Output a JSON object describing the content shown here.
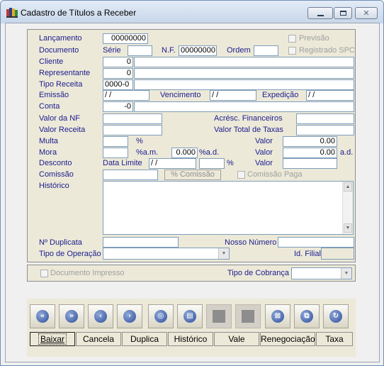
{
  "window": {
    "title": "Cadastro de Títulos a Receber"
  },
  "form": {
    "lancamento_label": "Lançamento",
    "lancamento_value": "00000000",
    "previsao_label": "Previsão",
    "documento_label": "Documento",
    "serie_label": "Série",
    "serie_value": "",
    "nf_label": "N.F.",
    "nf_value": "00000000",
    "ordem_label": "Ordem",
    "ordem_value": "",
    "registrado_spc_label": "Registrado SPC",
    "cliente_label": "Cliente",
    "cliente_value": "0",
    "representante_label": "Representante",
    "representante_value": "0",
    "tipo_receita_label": "Tipo Receita",
    "tipo_receita_value": "0000-0",
    "emissao_label": "Emissão",
    "emissao_value": " / /",
    "vencimento_label": "Vencimento",
    "vencimento_value": " / /",
    "expedicao_label": "Expedição",
    "expedicao_value": " / /",
    "conta_label": "Conta",
    "conta_value": "-0",
    "valor_nf_label": "Valor da NF",
    "acresc_label": "Acrésc. Financeiros",
    "valor_receita_label": "Valor Receita",
    "valor_total_taxas_label": "Valor Total de Taxas",
    "multa_label": "Multa",
    "multa_pct": "%",
    "multa_valor_label": "Valor",
    "multa_valor": "0.00",
    "mora_label": "Mora",
    "mora_am": "%a.m.",
    "mora_ad_value": "0.000",
    "mora_ad": "%a.d.",
    "mora_valor_label": "Valor",
    "mora_valor": "0.00",
    "mora_valor_unit": "a.d.",
    "desconto_label": "Desconto",
    "data_limite_label": "Data Limite",
    "data_limite_value": " / /",
    "desconto_pct": "%",
    "desconto_valor_label": "Valor",
    "comissao_label": "Comissão",
    "pct_comissao_btn": "% Comissão",
    "comissao_paga_label": "Comissão Paga",
    "historico_label": "Histórico",
    "nduplicata_label": "Nº Duplicata",
    "nosso_numero_label": "Nosso Número",
    "tipo_operacao_label": "Tipo de Operação",
    "id_filial_label": "Id. Filial"
  },
  "footer": {
    "doc_impresso_label": "Documento Impresso",
    "tipo_cobranca_label": "Tipo de Cobrança"
  },
  "toolbar": {
    "icons": [
      "«",
      "»",
      "‹",
      "›",
      "◎",
      "▤",
      "",
      "",
      "⊠",
      "⧉",
      "↻"
    ]
  },
  "buttons": {
    "baixar": "Baixar",
    "cancela": "Cancela",
    "duplica": "Duplica",
    "historico": "Histórico",
    "vale": "Vale",
    "renegociacao": "Renegociação",
    "taxa": "Taxa"
  }
}
